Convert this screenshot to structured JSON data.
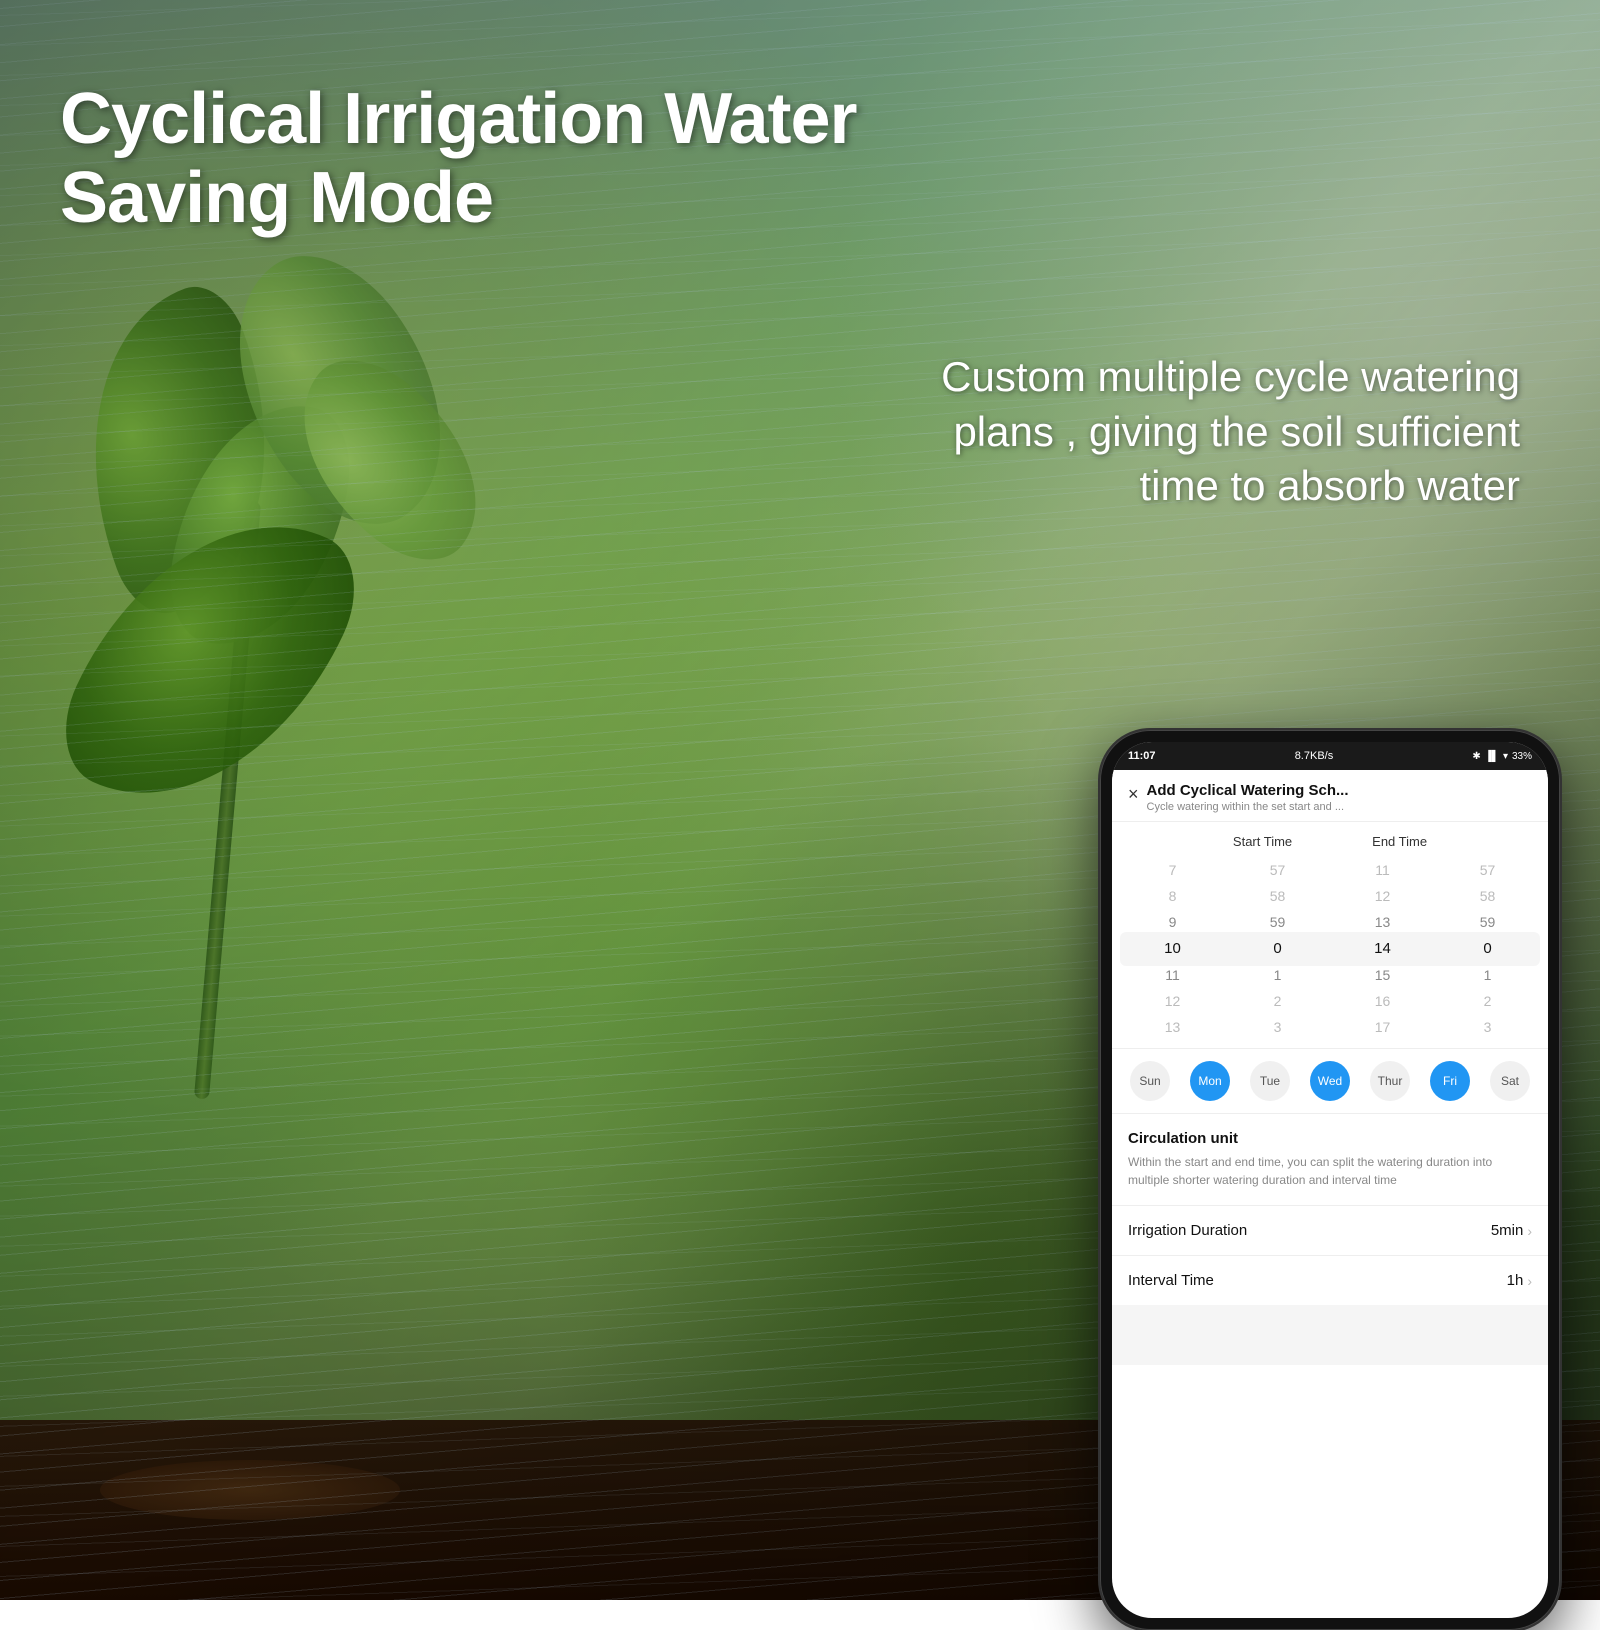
{
  "page": {
    "main_title": "Cyclical Irrigation Water Saving Mode",
    "subtitle": "Custom multiple cycle watering plans , giving the soil sufficient time to absorb water"
  },
  "phone": {
    "status_bar": {
      "time": "11:07",
      "network": "8.7KB/s",
      "battery": "33"
    },
    "header": {
      "title": "Add Cyclical Watering Sch...",
      "subtitle": "Cycle watering within the set start and ...",
      "close_icon": "×"
    },
    "time_picker": {
      "start_time_label": "Start Time",
      "end_time_label": "End Time",
      "rows": [
        {
          "hour1": "7",
          "min1": "57",
          "hour2": "11",
          "min2": "57"
        },
        {
          "hour1": "8",
          "min1": "58",
          "hour2": "12",
          "min2": "58"
        },
        {
          "hour1": "9",
          "min1": "59",
          "hour2": "13",
          "min2": "59"
        },
        {
          "hour1": "10",
          "min1": "0",
          "hour2": "14",
          "min2": "0",
          "selected": true
        },
        {
          "hour1": "11",
          "min1": "1",
          "hour2": "15",
          "min2": "1"
        },
        {
          "hour1": "12",
          "min1": "2",
          "hour2": "16",
          "min2": "2"
        },
        {
          "hour1": "13",
          "min1": "3",
          "hour2": "17",
          "min2": "3"
        }
      ]
    },
    "days": [
      {
        "label": "Sun",
        "active": false
      },
      {
        "label": "Mon",
        "active": true
      },
      {
        "label": "Tue",
        "active": false
      },
      {
        "label": "Wed",
        "active": true
      },
      {
        "label": "Thur",
        "active": false
      },
      {
        "label": "Fri",
        "active": true
      },
      {
        "label": "Sat",
        "active": false
      }
    ],
    "circulation": {
      "title": "Circulation unit",
      "description": "Within the start and end time, you can split the watering duration into multiple shorter watering duration and interval time"
    },
    "settings": [
      {
        "label": "Irrigation Duration",
        "value": "5min",
        "chevron": "›"
      },
      {
        "label": "Interval Time",
        "value": "1h",
        "chevron": "›"
      }
    ],
    "colors": {
      "active_day": "#2196F3",
      "inactive_day": "#f0f0f0"
    }
  }
}
